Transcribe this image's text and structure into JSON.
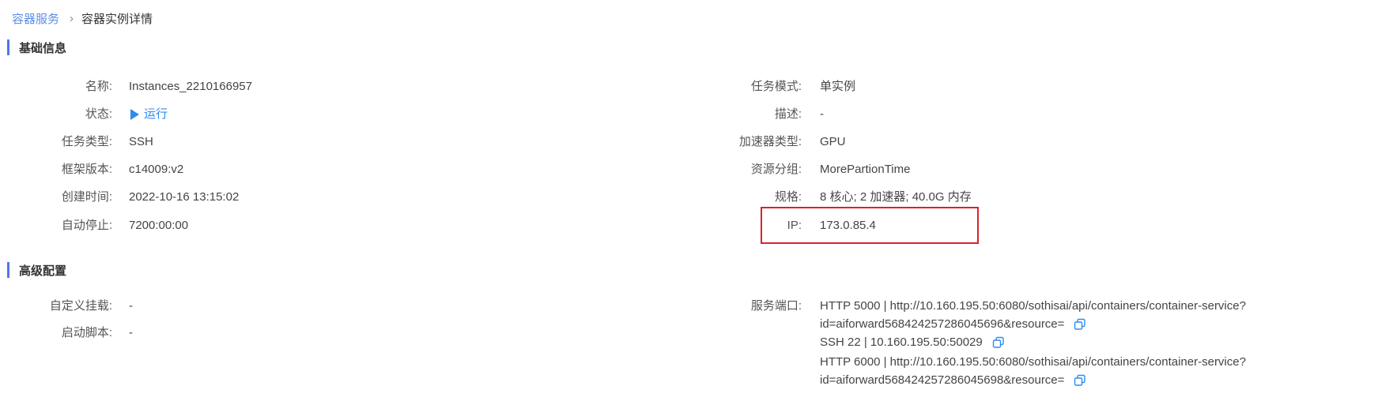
{
  "breadcrumb": {
    "parent": "容器服务",
    "current": "容器实例详情"
  },
  "sections": {
    "basic": "基础信息",
    "advanced": "高级配置"
  },
  "basic_left": [
    {
      "label": "名称:",
      "value": "Instances_2210166957"
    },
    {
      "label": "状态:",
      "value": "运行"
    },
    {
      "label": "任务类型:",
      "value": "SSH"
    },
    {
      "label": "框架版本:",
      "value": "c14009:v2"
    },
    {
      "label": "创建时间:",
      "value": "2022-10-16 13:15:02"
    },
    {
      "label": "自动停止:",
      "value": "7200:00:00"
    }
  ],
  "basic_right": [
    {
      "label": "任务模式:",
      "value": "单实例"
    },
    {
      "label": "描述:",
      "value": "-"
    },
    {
      "label": "加速器类型:",
      "value": "GPU"
    },
    {
      "label": "资源分组:",
      "value": "MorePartionTime"
    },
    {
      "label": "规格:",
      "value": "8 核心; 2 加速器; 40.0G 内存"
    },
    {
      "label": "IP:",
      "value": "173.0.85.4"
    }
  ],
  "advanced_left": [
    {
      "label": "自定义挂载:",
      "value": "-"
    },
    {
      "label": "启动脚本:",
      "value": "-"
    }
  ],
  "service_ports": {
    "label": "服务端口:",
    "lines": [
      "HTTP 5000 | http://10.160.195.50:6080/sothisai/api/containers/container-service?",
      "id=aiforward568424257286045696&resource=",
      "SSH 22 | 10.160.195.50:50029",
      "HTTP 6000 | http://10.160.195.50:6080/sothisai/api/containers/container-service?",
      "id=aiforward568424257286045698&resource="
    ]
  },
  "colors": {
    "link": "#5a8de8",
    "accent_bar": "#4a79e8",
    "status": "#2d8cf0",
    "highlight_box": "#d9232a"
  },
  "icons": {
    "status": "play-triangle-icon",
    "copy": "copy-icon"
  }
}
